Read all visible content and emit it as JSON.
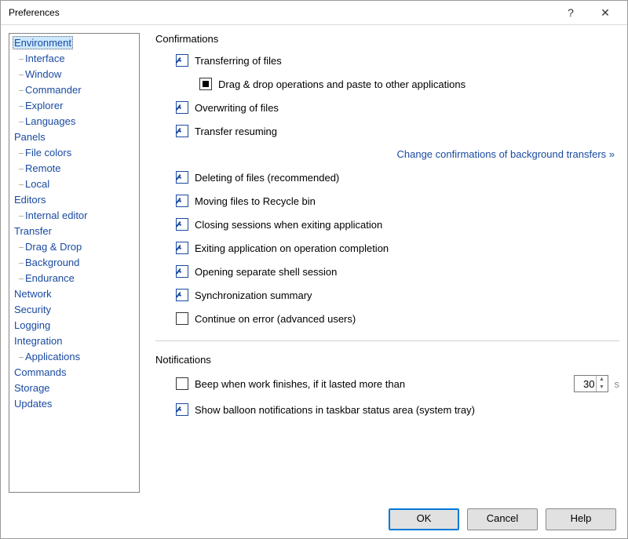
{
  "window": {
    "title": "Preferences"
  },
  "tree": [
    {
      "label": "Environment",
      "selected": true,
      "children": [
        {
          "label": "Interface"
        },
        {
          "label": "Window"
        },
        {
          "label": "Commander"
        },
        {
          "label": "Explorer"
        },
        {
          "label": "Languages"
        }
      ]
    },
    {
      "label": "Panels",
      "children": [
        {
          "label": "File colors"
        },
        {
          "label": "Remote"
        },
        {
          "label": "Local"
        }
      ]
    },
    {
      "label": "Editors",
      "children": [
        {
          "label": "Internal editor"
        }
      ]
    },
    {
      "label": "Transfer",
      "children": [
        {
          "label": "Drag & Drop"
        },
        {
          "label": "Background"
        },
        {
          "label": "Endurance"
        }
      ]
    },
    {
      "label": "Network"
    },
    {
      "label": "Security"
    },
    {
      "label": "Logging"
    },
    {
      "label": "Integration",
      "children": [
        {
          "label": "Applications"
        }
      ]
    },
    {
      "label": "Commands"
    },
    {
      "label": "Storage"
    },
    {
      "label": "Updates"
    }
  ],
  "sections": {
    "confirmations": {
      "title": "Confirmations",
      "transferring": "Transferring of files",
      "dragdrop": "Drag & drop operations and paste to other applications",
      "overwriting": "Overwriting of files",
      "resuming": "Transfer resuming",
      "bglink": "Change confirmations of background transfers »",
      "deleting": "Deleting of files (recommended)",
      "recycle": "Moving files to Recycle bin",
      "closing": "Closing sessions when exiting application",
      "exiting": "Exiting application on operation completion",
      "shell": "Opening separate shell session",
      "sync": "Synchronization summary",
      "cont": "Continue on error (advanced users)"
    },
    "notifications": {
      "title": "Notifications",
      "beep": "Beep when work finishes, if it lasted more than",
      "beep_seconds": "30",
      "beep_unit": "s",
      "balloon": "Show balloon notifications in taskbar status area (system tray)"
    }
  },
  "buttons": {
    "ok": "OK",
    "cancel": "Cancel",
    "help": "Help"
  },
  "checkbox_states": {
    "transferring": true,
    "dragdrop": "indeterminate",
    "overwriting": true,
    "resuming": true,
    "deleting": true,
    "recycle": true,
    "closing": true,
    "exiting": true,
    "shell": true,
    "sync": true,
    "cont": false,
    "beep": false,
    "balloon": true
  }
}
